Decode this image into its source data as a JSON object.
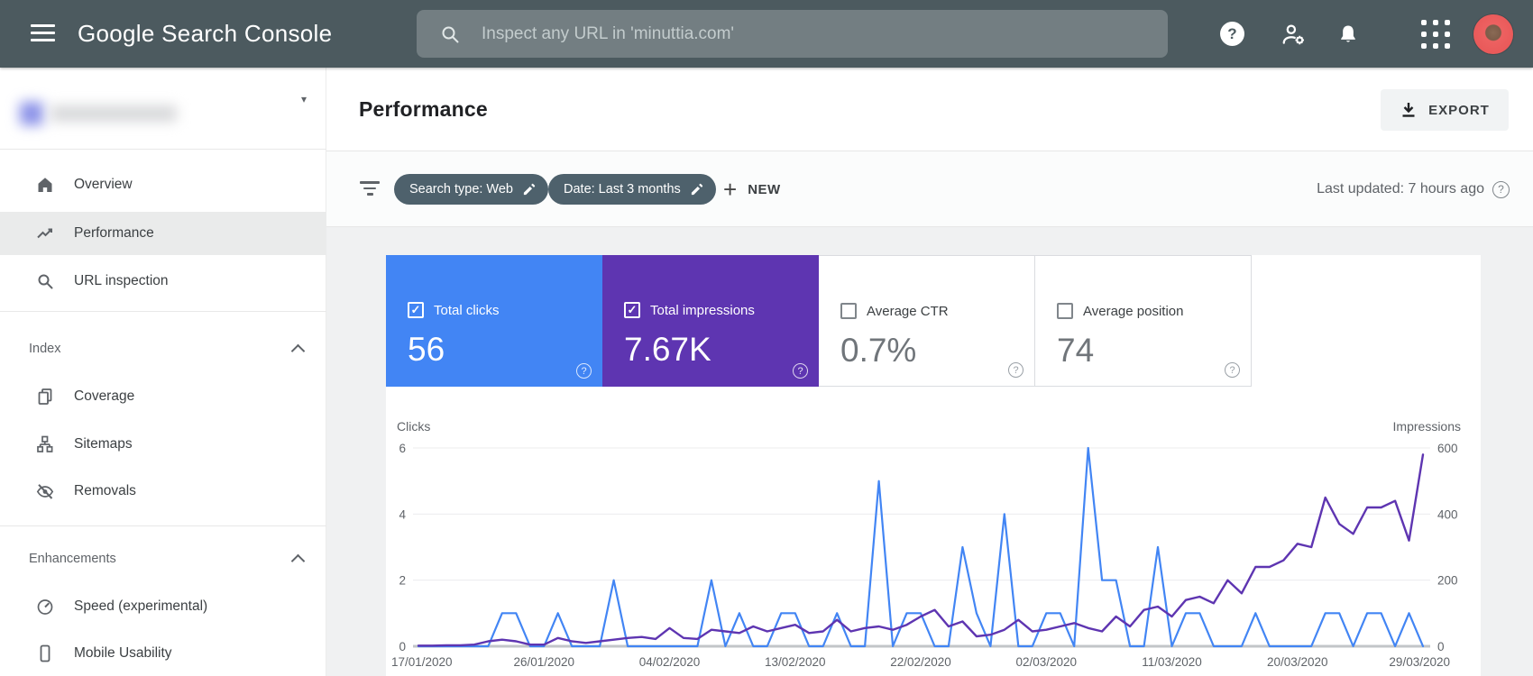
{
  "topbar": {
    "logo": "Google Search Console",
    "search_placeholder": "Inspect any URL in 'minuttia.com'"
  },
  "sidebar": {
    "nav": [
      {
        "label": "Overview"
      },
      {
        "label": "Performance",
        "selected": true
      },
      {
        "label": "URL inspection"
      }
    ],
    "sections": [
      {
        "header": "Index",
        "items": [
          "Coverage",
          "Sitemaps",
          "Removals"
        ]
      },
      {
        "header": "Enhancements",
        "items": [
          "Speed (experimental)",
          "Mobile Usability"
        ]
      }
    ]
  },
  "header": {
    "title": "Performance",
    "export_label": "EXPORT"
  },
  "filter_bar": {
    "chips": [
      {
        "label": "Search type: Web"
      },
      {
        "label": "Date: Last 3 months"
      }
    ],
    "new_label": "NEW",
    "last_updated": "Last updated: 7 hours ago"
  },
  "metrics": [
    {
      "label": "Total clicks",
      "value": "56",
      "selected": true,
      "color": "#4285f4"
    },
    {
      "label": "Total impressions",
      "value": "7.67K",
      "selected": true,
      "color": "#5e35b1"
    },
    {
      "label": "Average CTR",
      "value": "0.7%",
      "selected": false
    },
    {
      "label": "Average position",
      "value": "74",
      "selected": false
    }
  ],
  "glyphs": {
    "caret_down": "▾",
    "plus": "+",
    "question": "?",
    "check": "✓"
  },
  "chart_data": {
    "type": "line",
    "title": "Performance over time",
    "x_tick_labels": [
      "17/01/2020",
      "26/01/2020",
      "04/02/2020",
      "13/02/2020",
      "22/02/2020",
      "02/03/2020",
      "11/03/2020",
      "20/03/2020",
      "29/03/2020"
    ],
    "x_tick_positions": [
      0,
      9,
      18,
      27,
      36,
      45,
      54,
      63,
      72
    ],
    "left_axis": {
      "label": "Clicks",
      "ticks": [
        6,
        4,
        2,
        0
      ],
      "range": [
        0,
        6
      ]
    },
    "right_axis": {
      "label": "Impressions",
      "ticks": [
        600,
        400,
        200,
        0
      ],
      "range": [
        0,
        600
      ]
    },
    "grid": true,
    "legend_position": "none",
    "series": [
      {
        "name": "Clicks",
        "axis": "left",
        "color": "#4285f4",
        "values": [
          0,
          0,
          0,
          0,
          0,
          0,
          1,
          1,
          0,
          0,
          1,
          0,
          0,
          0,
          2,
          0,
          0,
          0,
          0,
          0,
          0,
          2,
          0,
          1,
          0,
          0,
          1,
          1,
          0,
          0,
          1,
          0,
          0,
          5,
          0,
          1,
          1,
          0,
          0,
          3,
          1,
          0,
          4,
          0,
          0,
          1,
          1,
          0,
          6,
          2,
          2,
          0,
          0,
          3,
          0,
          1,
          1,
          0,
          0,
          0,
          1,
          0,
          0,
          0,
          0,
          1,
          1,
          0,
          1,
          1,
          0,
          1,
          0
        ]
      },
      {
        "name": "Impressions",
        "axis": "right",
        "color": "#5e35b1",
        "values": [
          2,
          2,
          3,
          3,
          5,
          15,
          20,
          15,
          5,
          5,
          25,
          15,
          10,
          15,
          20,
          25,
          28,
          22,
          55,
          25,
          22,
          50,
          45,
          40,
          60,
          45,
          55,
          65,
          40,
          45,
          80,
          45,
          55,
          60,
          50,
          65,
          90,
          110,
          60,
          75,
          30,
          35,
          50,
          80,
          45,
          50,
          60,
          70,
          55,
          45,
          90,
          60,
          110,
          120,
          90,
          140,
          150,
          130,
          200,
          160,
          240,
          240,
          260,
          310,
          300,
          450,
          370,
          340,
          420,
          420,
          440,
          320,
          580
        ]
      }
    ]
  }
}
